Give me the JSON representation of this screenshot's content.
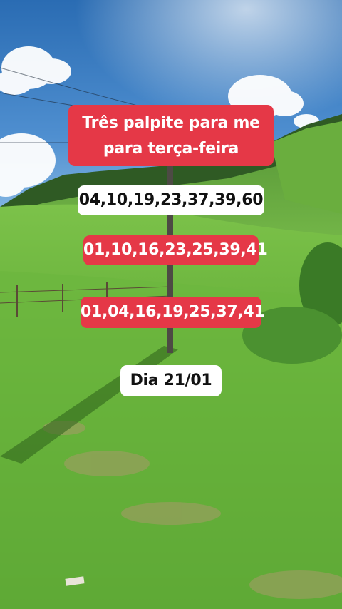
{
  "overlay": {
    "title_lines": [
      "Três palpite para me",
      "para terça-feira"
    ],
    "number_rows": [
      "04,10,19,23,37,39,60",
      "01,10,16,23,25,39,41",
      "01,04,16,19,25,37,41"
    ],
    "date_text": "Dia 21/01"
  },
  "colors": {
    "caption_red": "#e53847",
    "caption_white": "#ffffff",
    "sky": "#3f7fc2",
    "grass": "#6db83a"
  }
}
